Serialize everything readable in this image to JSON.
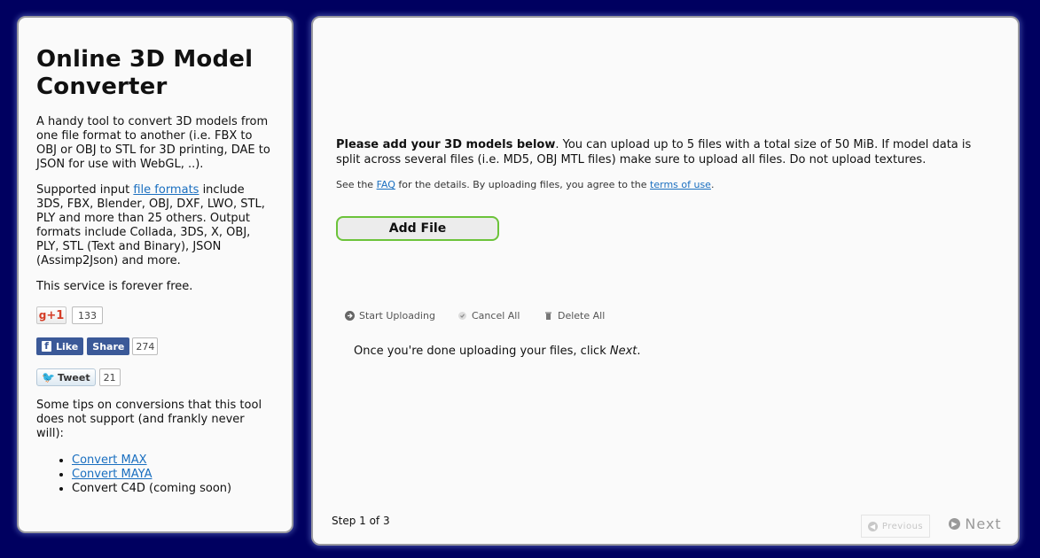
{
  "sidebar": {
    "title": "Online 3D Model Converter",
    "intro": "A handy tool to convert 3D models from one file format to another (i.e. FBX to OBJ or OBJ to STL for 3D printing, DAE to JSON for use with WebGL, ..).",
    "formats_pre": "Supported input ",
    "formats_link": "file formats",
    "formats_post": " include 3DS, FBX, Blender, OBJ, DXF, LWO, STL, PLY and more than 25 others. Output formats include Collada, 3DS, X, OBJ, PLY, STL (Text and Binary), JSON (Assimp2Json) and more.",
    "free": "This service is forever free.",
    "gplus_label": "+1",
    "gplus_count": "133",
    "fb_like": "Like",
    "fb_share": "Share",
    "fb_count": "274",
    "tweet_label": "Tweet",
    "tweet_count": "21",
    "tips_intro": "Some tips on conversions that this tool does not support (and frankly never will):",
    "tips": [
      "Convert MAX",
      "Convert MAYA",
      "Convert C4D (coming soon)"
    ]
  },
  "main": {
    "intro_bold": "Please add your 3D models below",
    "intro_rest": ". You can upload up to 5 files with a total size of 50 MiB. If model data is split across several files (i.e. MD5, OBJ MTL files) make sure to upload all files. Do not upload textures.",
    "faq_pre": "See the ",
    "faq_link": "FAQ",
    "faq_mid": " for the details. By uploading files, you agree to the ",
    "terms_link": "terms of use",
    "faq_post": ".",
    "add_file": "Add File",
    "start_uploading": "Start Uploading",
    "cancel_all": "Cancel All",
    "delete_all": "Delete All",
    "done_pre": "Once you're done uploading your files, click ",
    "done_next": "Next",
    "done_post": ".",
    "step": "Step 1 of 3",
    "previous": "Previous",
    "next": "Next"
  }
}
